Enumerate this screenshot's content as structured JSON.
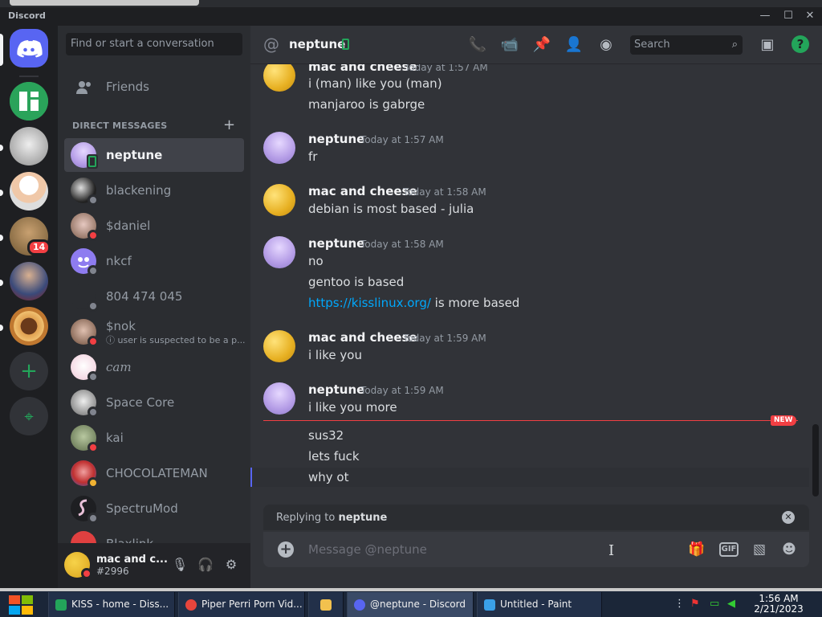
{
  "window": {
    "app_name": "Discord"
  },
  "sidebar": {
    "search_placeholder": "Find or start a conversation",
    "friends_label": "Friends",
    "dm_header": "DIRECT MESSAGES",
    "dms": [
      {
        "name": "neptune",
        "status": "mobile",
        "selected": true
      },
      {
        "name": "blackening",
        "status": "offline"
      },
      {
        "name": "$daniel",
        "status": "dnd"
      },
      {
        "name": "nkcf",
        "status": "offline"
      },
      {
        "name": "804 474 045",
        "status": "offline"
      },
      {
        "name": "$nok",
        "status": "dnd",
        "sub": "ⓘ user is suspected to be a p..."
      },
      {
        "name": "cam",
        "status": "offline"
      },
      {
        "name": "Space Core",
        "status": "offline"
      },
      {
        "name": "kai",
        "status": "dnd"
      },
      {
        "name": "CHOCOLATEMAN",
        "status": "idle"
      },
      {
        "name": "SpectruMod",
        "status": "offline"
      },
      {
        "name": "Blaxlink",
        "status": "offline"
      }
    ]
  },
  "servers": {
    "badge": "14"
  },
  "user_panel": {
    "name": "mac and c...",
    "tag": "#2996"
  },
  "chat": {
    "channel_name": "neptune",
    "search_placeholder": "Search",
    "messages": [
      {
        "author": "mac and cheese",
        "time": "Today at 1:57 AM",
        "lines": [
          "i (man) like you (man)",
          "manjaroo is gabrge"
        ]
      },
      {
        "author": "neptune",
        "time": "Today at 1:57 AM",
        "lines": [
          "fr"
        ]
      },
      {
        "author": "mac and cheese",
        "time": "Today at 1:58 AM",
        "lines": [
          "debian is most based - julia"
        ]
      },
      {
        "author": "neptune",
        "time": "Today at 1:58 AM",
        "lines": [
          "no",
          "gentoo is based"
        ],
        "link": "https://kisslinux.org/",
        "link_suffix": " is more based"
      },
      {
        "author": "mac and cheese",
        "time": "Today at 1:59 AM",
        "lines": [
          "i like you"
        ]
      },
      {
        "author": "neptune",
        "time": "Today at 1:59 AM",
        "lines": [
          "i like you more"
        ]
      }
    ],
    "new_label": "NEW",
    "new_lines": [
      "sus32",
      "lets fuck",
      "why ot"
    ],
    "replying_prefix": "Replying to",
    "replying_to": "neptune",
    "composer_placeholder": "Message @neptune",
    "gif_label": "GIF"
  },
  "taskbar": {
    "items": [
      {
        "label": "KISS - home - Diss...",
        "color": "#23a55a"
      },
      {
        "label": "Piper Perri Porn Vid...",
        "color": "#e8453c"
      },
      {
        "label": "",
        "color": "#f2c14e"
      },
      {
        "label": "@neptune - Discord",
        "color": "#5865f2"
      },
      {
        "label": "Untitled - Paint",
        "color": "#3aa0e8"
      }
    ],
    "time": "1:56 AM",
    "date": "2/21/2023"
  }
}
